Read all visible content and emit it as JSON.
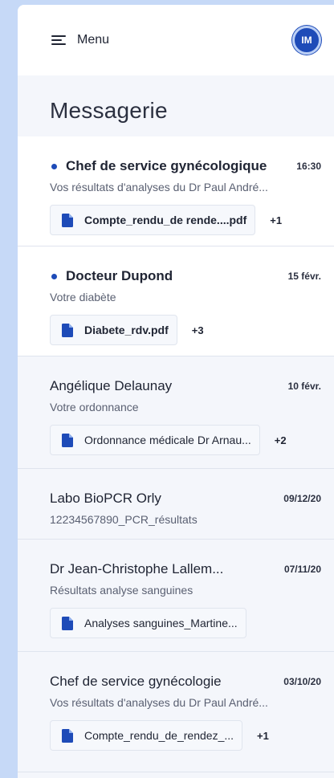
{
  "header": {
    "menu_label": "Menu",
    "avatar_initials": "IM"
  },
  "page_title": "Messagerie",
  "colors": {
    "accent": "#1e4bb8",
    "background": "#c6d9f7"
  },
  "messages": [
    {
      "sender": "Chef de service gynécologique",
      "date": "16:30",
      "subject": "Vos résultats d'analyses du Dr Paul André...",
      "attachment": "Compte_rendu_de rende....pdf",
      "more": "+1",
      "unread": true
    },
    {
      "sender": "Docteur Dupond",
      "date": "15 févr.",
      "subject": "Votre diabète",
      "attachment": "Diabete_rdv.pdf",
      "more": "+3",
      "unread": true
    },
    {
      "sender": "Angélique Delaunay",
      "date": "10 févr.",
      "subject": "Votre ordonnance",
      "attachment": "Ordonnance médicale Dr Arnau...",
      "more": "+2",
      "unread": false
    },
    {
      "sender": "Labo BioPCR Orly",
      "date": "09/12/20",
      "subject": "12234567890_PCR_résultats",
      "attachment": null,
      "more": null,
      "unread": false
    },
    {
      "sender": "Dr Jean-Christophe Lallem...",
      "date": "07/11/20",
      "subject": "Résultats analyse sanguines",
      "attachment": "Analyses sanguines_Martine...",
      "more": null,
      "unread": false
    },
    {
      "sender": "Chef de service gynécologie",
      "date": "03/10/20",
      "subject": "Vos résultats d'analyses du Dr Paul André...",
      "attachment": "Compte_rendu_de_rendez_...",
      "more": "+1",
      "unread": false
    }
  ]
}
